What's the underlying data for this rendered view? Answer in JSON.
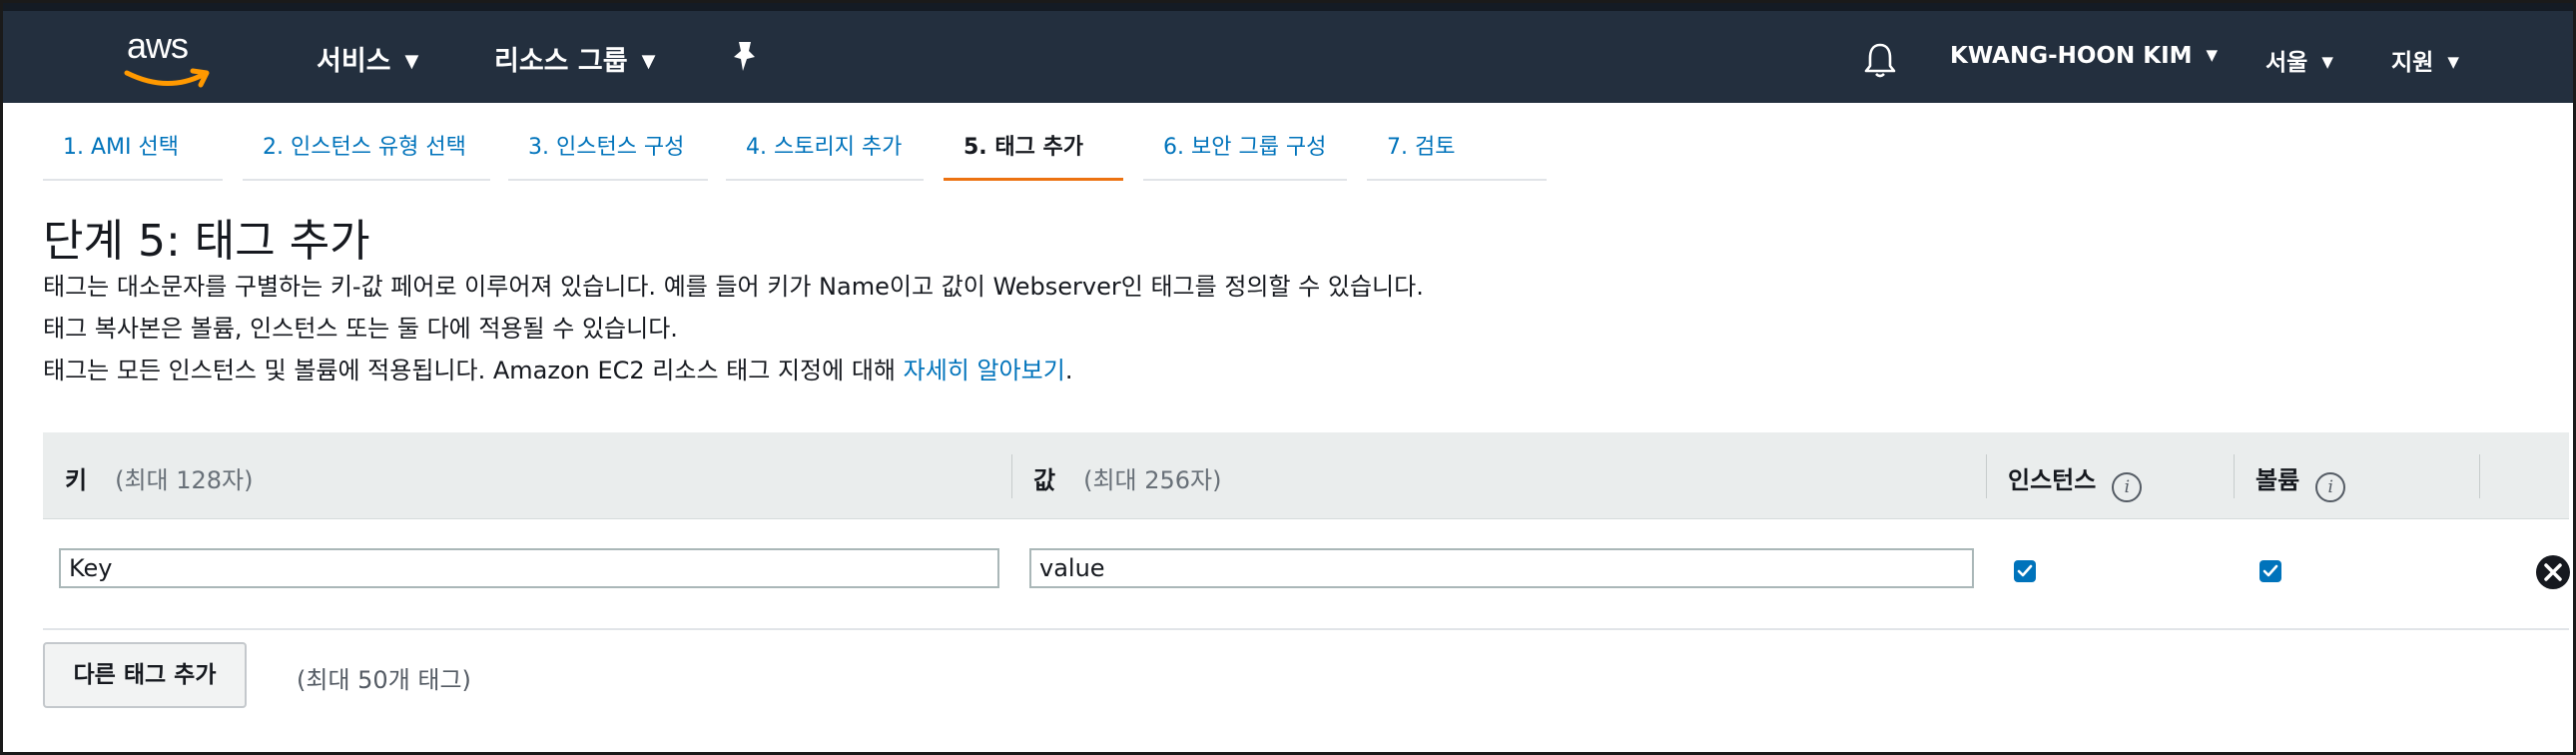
{
  "nav": {
    "logo": "aws",
    "services": "서비스",
    "resource_groups": "리소스 그룹",
    "user": "KWANG-HOON KIM",
    "region": "서울",
    "support": "지원"
  },
  "wizard_tabs": [
    {
      "label": "1. AMI 선택"
    },
    {
      "label": "2. 인스턴스 유형 선택"
    },
    {
      "label": "3. 인스턴스 구성"
    },
    {
      "label": "4. 스토리지 추가"
    },
    {
      "label": "5. 태그 추가"
    },
    {
      "label": "6. 보안 그룹 구성"
    },
    {
      "label": "7. 검토"
    }
  ],
  "page": {
    "title": "단계 5: 태그 추가",
    "line1": "태그는 대소문자를 구별하는 키-값 페어로 이루어져 있습니다. 예를 들어 키가 Name이고 값이 Webserver인 태그를 정의할 수 있습니다.",
    "line2": "태그 복사본은 볼륨, 인스턴스 또는 둘 다에 적용될 수 있습니다.",
    "line3": "태그는 모든 인스턴스 및 볼륨에 적용됩니다. Amazon EC2 리소스 태그 지정에 대해 ",
    "learn_more": "자세히 알아보기",
    "line3_end": "."
  },
  "table": {
    "key_header": "키",
    "key_hint": "(최대 128자)",
    "value_header": "값",
    "value_hint": "(최대 256자)",
    "instances_header": "인스턴스",
    "volumes_header": "볼륨",
    "rows": [
      {
        "key": "Key",
        "value": "value",
        "instances": true,
        "volumes": true
      }
    ]
  },
  "actions": {
    "add_tag": "다른 태그 추가",
    "add_tag_hint": "(최대 50개 태그)"
  },
  "colors": {
    "nav_bg": "#232f3e",
    "link": "#0073bb",
    "active_tab": "#ec7211",
    "header_bg": "#eaeded"
  }
}
